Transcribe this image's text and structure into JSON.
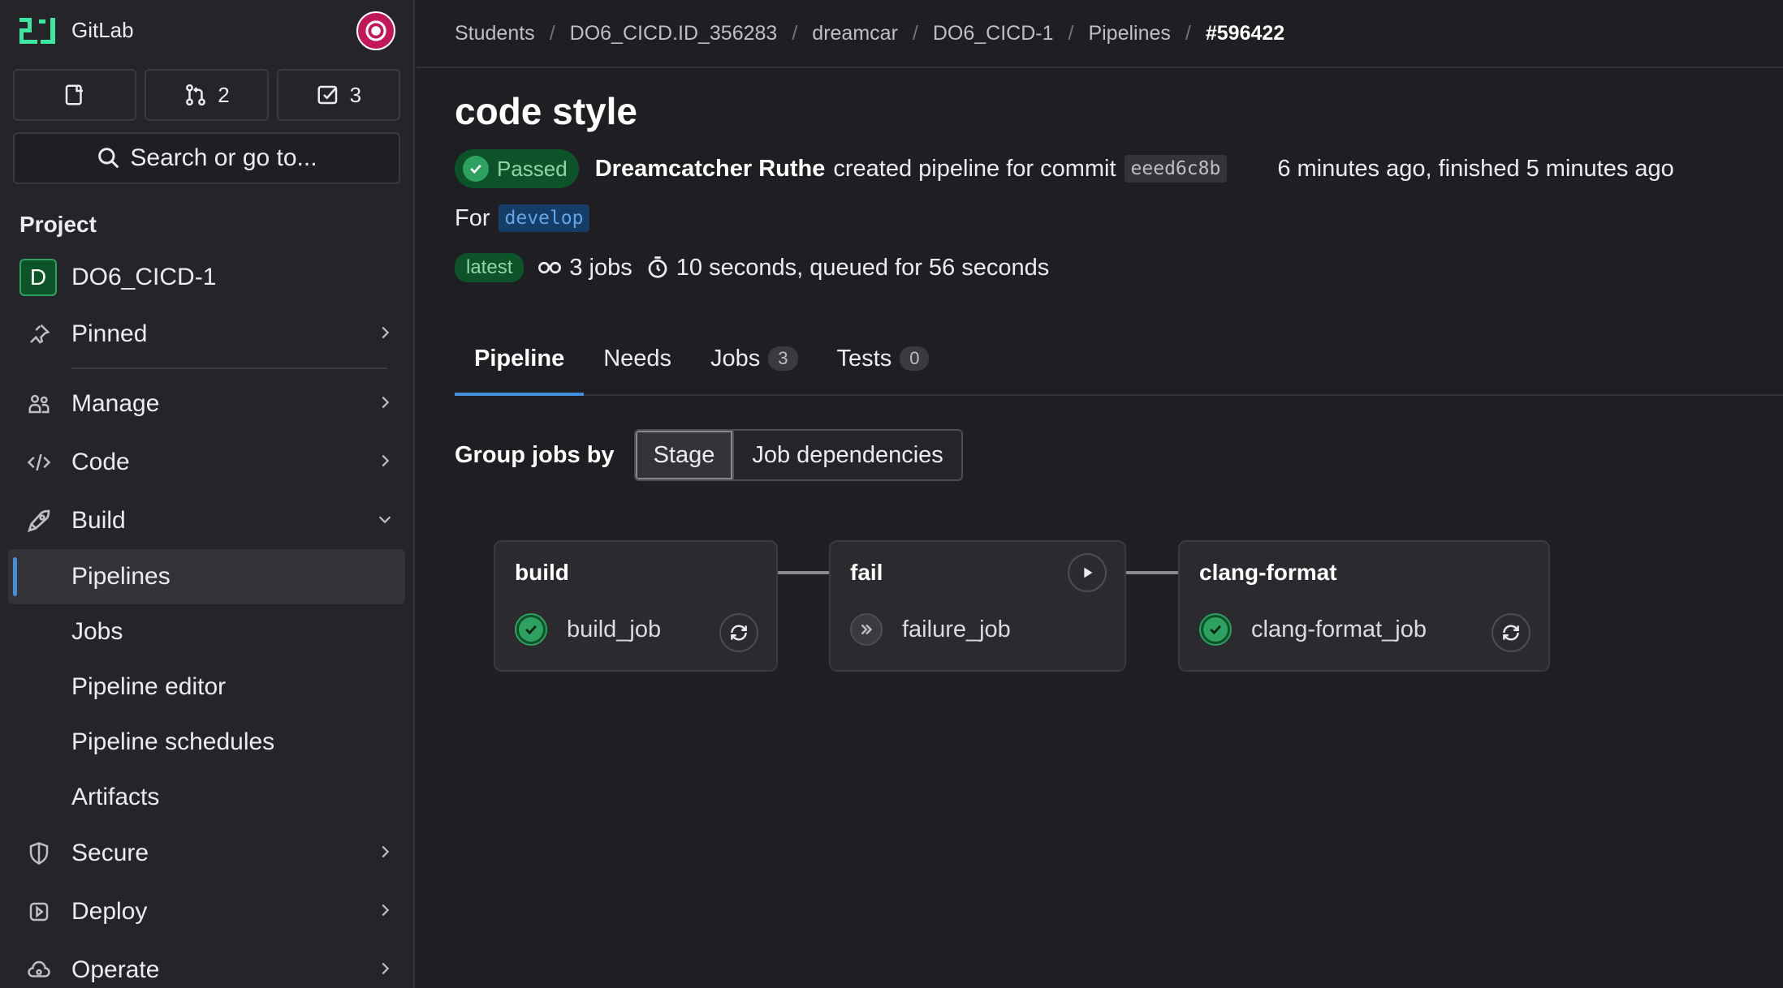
{
  "sidebar": {
    "brand": "GitLab",
    "counters": {
      "merge_requests": "2",
      "todos": "3"
    },
    "search_placeholder": "Search or go to...",
    "section_title": "Project",
    "project": {
      "initial": "D",
      "name": "DO6_CICD-1"
    },
    "items": [
      {
        "label": "Pinned",
        "icon": "pin-icon"
      },
      {
        "label": "Manage",
        "icon": "users-icon"
      },
      {
        "label": "Code",
        "icon": "code-icon"
      },
      {
        "label": "Build",
        "icon": "rocket-icon"
      },
      {
        "label": "Secure",
        "icon": "shield-icon"
      },
      {
        "label": "Deploy",
        "icon": "deploy-icon"
      },
      {
        "label": "Operate",
        "icon": "cloud-gear-icon"
      }
    ],
    "build_subitems": [
      "Pipelines",
      "Jobs",
      "Pipeline editor",
      "Pipeline schedules",
      "Artifacts"
    ]
  },
  "breadcrumb": [
    "Students",
    "DO6_CICD.ID_356283",
    "dreamcar",
    "DO6_CICD-1",
    "Pipelines",
    "#596422"
  ],
  "pipeline": {
    "title": "code style",
    "status": "Passed",
    "author": "Dreamcatcher Ruthe",
    "created_text": "created pipeline for commit",
    "commit": "eeed6c8b",
    "times": "6 minutes ago, finished 5 minutes ago",
    "for_label": "For",
    "branch": "develop",
    "latest_badge": "latest",
    "jobs_text": "3 jobs",
    "duration_text": "10 seconds, queued for 56 seconds"
  },
  "tabs": [
    {
      "label": "Pipeline"
    },
    {
      "label": "Needs"
    },
    {
      "label": "Jobs",
      "count": "3"
    },
    {
      "label": "Tests",
      "count": "0"
    }
  ],
  "group_by": {
    "label": "Group jobs by",
    "options": [
      "Stage",
      "Job dependencies"
    ],
    "selected": "Stage"
  },
  "stages": [
    {
      "name": "build",
      "job": "build_job",
      "status": "passed",
      "action": "retry"
    },
    {
      "name": "fail",
      "job": "failure_job",
      "status": "skipped",
      "action": "play"
    },
    {
      "name": "clang-format",
      "job": "clang-format_job",
      "status": "passed",
      "action": "retry"
    }
  ],
  "colors": {
    "accent": "#428fdc",
    "success": "#2da160",
    "background": "#1f1f23",
    "sidebar": "#252529"
  }
}
